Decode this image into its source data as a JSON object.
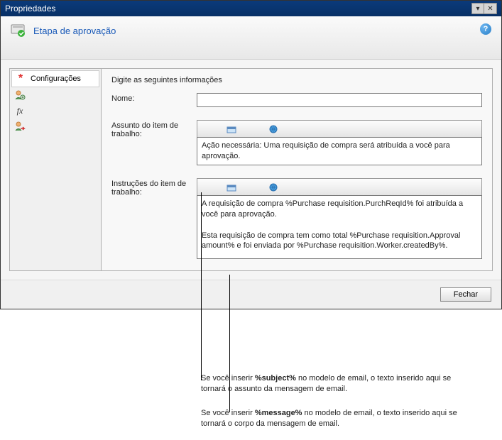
{
  "titlebar": {
    "title": "Propriedades"
  },
  "header": {
    "title": "Etapa de aprovação"
  },
  "sidebar": {
    "items": [
      {
        "label": "Configurações"
      }
    ]
  },
  "form": {
    "heading": "Digite as seguintes informações",
    "name_label": "Nome:",
    "name_value": "",
    "subject_label": "Assunto do item de trabalho:",
    "subject_value": "Ação necessária: Uma requisição de compra será atribuída a você para aprovação.",
    "instructions_label": "Instruções do item de trabalho:",
    "instructions_value": "A requisição de compra %Purchase requisition.PurchReqId% foi atribuída a você para aprovação.\n\nEsta requisição de compra tem como total %Purchase requisition.Approval amount% e foi enviada por %Purchase requisition.Worker.createdBy%."
  },
  "footer": {
    "close_label": "Fechar"
  },
  "callouts": {
    "c1_pre": "Se você inserir ",
    "c1_bold": "%subject%",
    "c1_post": " no modelo de email, o texto inserido aqui se tornará o assunto da mensagem de email.",
    "c2_pre": "Se você inserir ",
    "c2_bold": "%message%",
    "c2_post": " no modelo de email, o texto inserido aqui se tornará o corpo da mensagem de email."
  }
}
